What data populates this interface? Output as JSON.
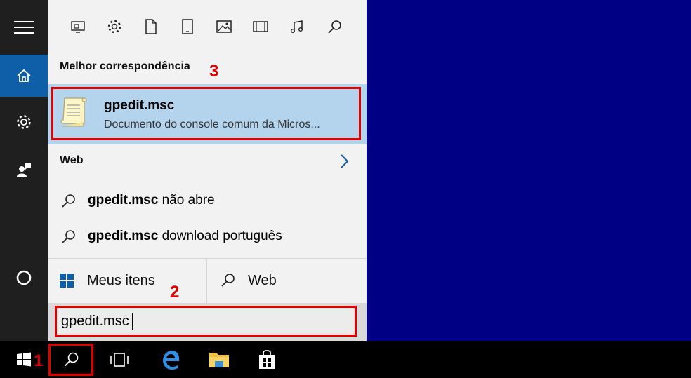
{
  "filter_icons": [
    "apps-icon",
    "settings-icon",
    "document-icon",
    "tablet-icon",
    "photos-icon",
    "videos-icon",
    "music-icon",
    "search-icon"
  ],
  "rail": {
    "items": [
      {
        "name": "hamburger-menu-icon"
      },
      {
        "name": "home-icon",
        "active": true
      },
      {
        "name": "settings-icon"
      },
      {
        "name": "feedback-icon"
      },
      {
        "name": "cortana-icon"
      }
    ]
  },
  "best_match": {
    "header": "Melhor correspondência",
    "item": {
      "title": "gpedit.msc",
      "subtitle": "Documento do console comum da Micros..."
    }
  },
  "web": {
    "header": "Web",
    "suggestions": [
      {
        "bold": "gpedit.msc",
        "rest": " não abre"
      },
      {
        "bold": "gpedit.msc",
        "rest": " download português"
      }
    ]
  },
  "scope": {
    "my_stuff": "Meus itens",
    "web": "Web"
  },
  "search": {
    "value": "gpedit.msc"
  },
  "annotations": {
    "one": "1",
    "two": "2",
    "three": "3"
  },
  "colors": {
    "desktop": "#000084",
    "accent": "#0f5ea8",
    "highlight": "#b4d4ee",
    "annotation": "#e10000"
  }
}
